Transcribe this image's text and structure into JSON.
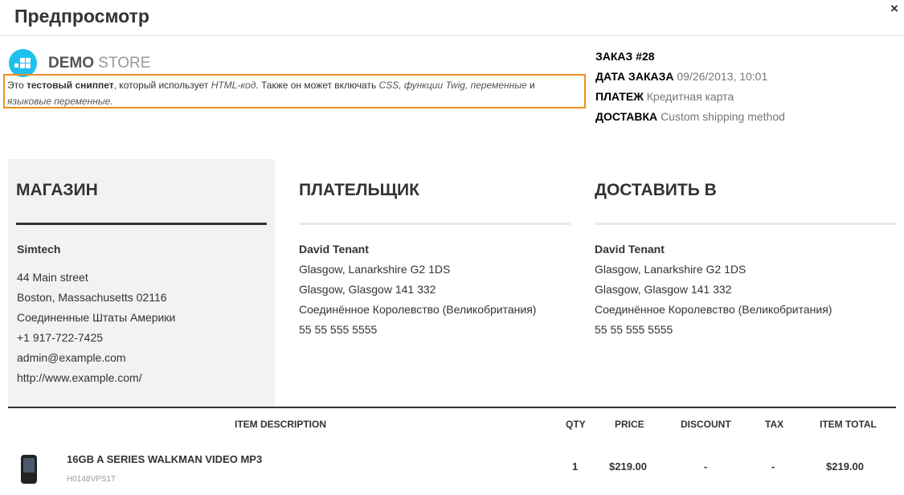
{
  "modal": {
    "title": "Предпросмотр",
    "close_symbol": "×"
  },
  "logo": {
    "strong": "DEMO",
    "light": "STORE"
  },
  "snippet": {
    "p1": "Это ",
    "p2": "тестовый сниппет",
    "p3": ", который использует ",
    "p4": "HTML-код",
    "p5": ". Также он может включать ",
    "p6": "CSS",
    "p7": ", ",
    "p8": "функции Twig",
    "p9": ", ",
    "p10": "переменные",
    "p11": " и ",
    "p12": "языковые переменные",
    "p13": "."
  },
  "order": {
    "number_label": "Заказ #28",
    "date_label": "Дата заказа",
    "date_value": "09/26/2013, 10:01",
    "payment_label": "Платеж",
    "payment_value": "Кредитная карта",
    "shipping_label": "Доставка",
    "shipping_value": "Custom shipping method"
  },
  "store": {
    "title": "МАГАЗИН",
    "name": "Simtech",
    "lines": [
      "44 Main street",
      "Boston, Massachusetts 02116",
      "Соединенные Штаты Америки",
      "+1 917-722-7425",
      "admin@example.com",
      "http://www.example.com/"
    ]
  },
  "billing": {
    "title": "ПЛАТЕЛЬЩИК",
    "name": "David Tenant",
    "lines": [
      "Glasgow, Lanarkshire G2 1DS",
      "Glasgow, Glasgow 141 332",
      "Соединённое Королевство (Великобритания)",
      "55 55 555 5555"
    ]
  },
  "shipping": {
    "title": "ДОСТАВИТЬ В",
    "name": "David Tenant",
    "lines": [
      "Glasgow, Lanarkshire G2 1DS",
      "Glasgow, Glasgow 141 332",
      "Соединённое Королевство (Великобритания)",
      "55 55 555 5555"
    ]
  },
  "table": {
    "headers": {
      "desc": "ITEM DESCRIPTION",
      "qty": "QTY",
      "price": "PRICE",
      "discount": "DISCOUNT",
      "tax": "TAX",
      "total": "ITEM TOTAL"
    },
    "rows": [
      {
        "name": "16GB A SERIES WALKMAN VIDEO MP3",
        "sku": "H0148VPS1T",
        "qty": "1",
        "price": "$219.00",
        "discount": "-",
        "tax": "-",
        "total": "$219.00"
      }
    ]
  },
  "colors": {
    "accent": "#1ec0ed",
    "snippet_border": "#f0901e",
    "store_bg": "#f2f2f2"
  }
}
